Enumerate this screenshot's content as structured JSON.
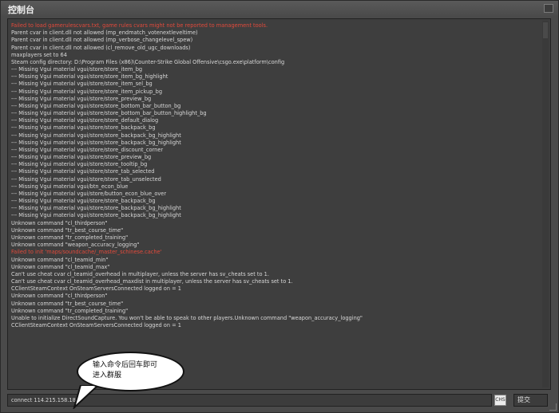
{
  "window": {
    "title": "控制台"
  },
  "console": {
    "lines": [
      {
        "text": "Failed to load gamerulescvars.txt, game rules cvars might not be reported to management tools.",
        "error": true
      },
      {
        "text": "Parent cvar in client.dll not allowed (mp_endmatch_votenextleveltime)"
      },
      {
        "text": "Parent cvar in client.dll not allowed (mp_verbose_changelevel_spew)"
      },
      {
        "text": "Parent cvar in client.dll not allowed (cl_remove_old_ugc_downloads)"
      },
      {
        "text": "maxplayers set to 64"
      },
      {
        "text": "Steam config directory: D:\\Program Files (x86)\\Counter-Strike Global Offensive\\csgo.exe\\platform\\config"
      },
      {
        "text": "--- Missing Vgui material vgui/store/store_item_bg"
      },
      {
        "text": "--- Missing Vgui material vgui/store/store_item_bg_highlight"
      },
      {
        "text": "--- Missing Vgui material vgui/store/store_item_sel_bg"
      },
      {
        "text": "--- Missing Vgui material vgui/store/store_item_pickup_bg"
      },
      {
        "text": "--- Missing Vgui material vgui/store/store_preview_bg"
      },
      {
        "text": "--- Missing Vgui material vgui/store/store_bottom_bar_button_bg"
      },
      {
        "text": "--- Missing Vgui material vgui/store/store_bottom_bar_button_highlight_bg"
      },
      {
        "text": "--- Missing Vgui material vgui/store/store_default_dialog"
      },
      {
        "text": "--- Missing Vgui material vgui/store/store_backpack_bg"
      },
      {
        "text": "--- Missing Vgui material vgui/store/store_backpack_bg_highlight"
      },
      {
        "text": "--- Missing Vgui material vgui/store/store_backpack_bg_highlight"
      },
      {
        "text": "--- Missing Vgui material vgui/store/store_discount_corner"
      },
      {
        "text": "--- Missing Vgui material vgui/store/store_preview_bg"
      },
      {
        "text": "--- Missing Vgui material vgui/store/store_tooltip_bg"
      },
      {
        "text": "--- Missing Vgui material vgui/store/store_tab_selected"
      },
      {
        "text": "--- Missing Vgui material vgui/store/store_tab_unselected"
      },
      {
        "text": "--- Missing Vgui material vgui/btn_econ_blue"
      },
      {
        "text": "--- Missing Vgui material vgui/store/button_econ_blue_over"
      },
      {
        "text": "--- Missing Vgui material vgui/store/store_backpack_bg"
      },
      {
        "text": "--- Missing Vgui material vgui/store/store_backpack_bg_highlight"
      },
      {
        "text": "--- Missing Vgui material vgui/store/store_backpack_bg_highlight"
      },
      {
        "text": "Unknown command \"cl_thirdperson\""
      },
      {
        "text": "Unknown command \"tr_best_course_time\""
      },
      {
        "text": "Unknown command \"tr_completed_training\""
      },
      {
        "text": "Unknown command \"weapon_accuracy_logging\""
      },
      {
        "text": "Failed to init 'maps/soundcache/_master_schinese.cache'",
        "error": true
      },
      {
        "text": "Unknown command \"cl_teamid_min\""
      },
      {
        "text": "Unknown command \"cl_teamid_max\""
      },
      {
        "text": "Can't use cheat cvar cl_teamid_overhead in multiplayer, unless the server has sv_cheats set to 1."
      },
      {
        "text": "Can't use cheat cvar cl_teamid_overhead_maxdist in multiplayer, unless the server has sv_cheats set to 1."
      },
      {
        "text": "CClientSteamContext OnSteamServersConnected logged on = 1"
      },
      {
        "text": "Unknown command \"cl_thirdperson\""
      },
      {
        "text": "Unknown command \"tr_best_course_time\""
      },
      {
        "text": "Unknown command \"tr_completed_training\""
      },
      {
        "text": "Unable to initialize DirectSoundCapture. You won't be able to speak to other players.Unknown command \"weapon_accuracy_logging\""
      },
      {
        "text": "CClientSteamContext OnSteamServersConnected logged on = 1"
      }
    ]
  },
  "callout": {
    "line1": "输入命令后回车即可",
    "line2": "进入群服"
  },
  "command": {
    "value": "connect 114.215.158.182"
  },
  "ime": {
    "label": "CHS"
  },
  "submit": {
    "label": "提交"
  },
  "colors": {
    "error": "#e24a3b",
    "text": "#d8d8d8",
    "background": "#3e3e3e"
  }
}
